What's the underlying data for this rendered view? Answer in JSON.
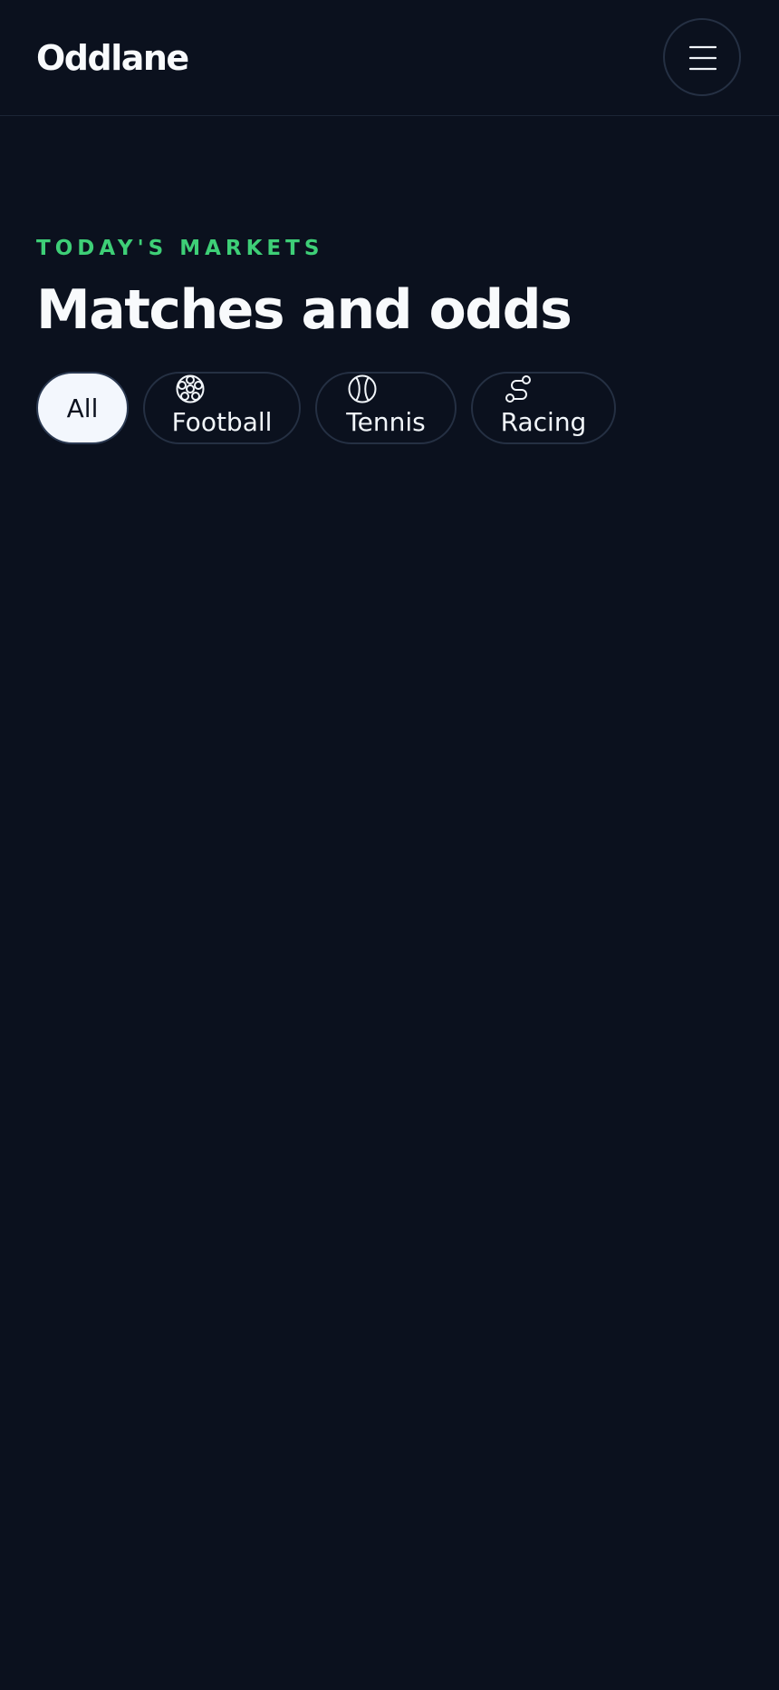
{
  "header": {
    "brand": "Oddlane",
    "menu_icon": "hamburger-menu-icon"
  },
  "hero": {
    "eyebrow": "TODAY'S MARKETS",
    "title": "Matches and odds"
  },
  "filters": {
    "selected": "All",
    "items": [
      {
        "label": "All",
        "icon": null
      },
      {
        "label": "Football",
        "icon": "soccer-ball-icon"
      },
      {
        "label": "Tennis",
        "icon": "tennis-ball-icon"
      },
      {
        "label": "Racing",
        "icon": "route-icon"
      }
    ]
  },
  "colors": {
    "background": "#0b111e",
    "accent": "#3ecf77",
    "chip_active_bg": "#f3f7fd",
    "border": "#253043"
  }
}
